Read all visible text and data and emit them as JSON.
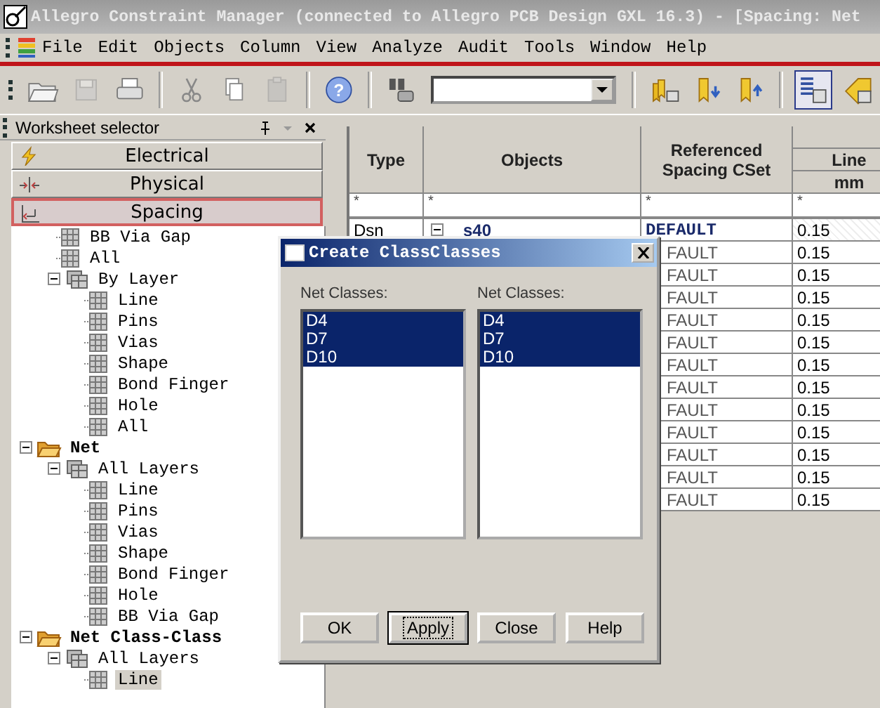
{
  "window": {
    "title": "Allegro Constraint Manager (connected to Allegro PCB Design GXL 16.3) - [Spacing:  Net"
  },
  "menu": [
    "File",
    "Edit",
    "Objects",
    "Column",
    "View",
    "Analyze",
    "Audit",
    "Tools",
    "Window",
    "Help"
  ],
  "toolbar": [
    {
      "kind": "open",
      "disabled": false
    },
    {
      "kind": "save",
      "disabled": true
    },
    {
      "kind": "print",
      "disabled": false
    },
    {
      "kind": "sep"
    },
    {
      "kind": "cut",
      "disabled": false
    },
    {
      "kind": "copy",
      "disabled": false
    },
    {
      "kind": "paste",
      "disabled": true
    },
    {
      "kind": "sep"
    },
    {
      "kind": "help",
      "glyph": "?",
      "disabled": false
    },
    {
      "kind": "sep"
    },
    {
      "kind": "find",
      "disabled": false
    },
    {
      "kind": "combo"
    },
    {
      "kind": "sep"
    },
    {
      "kind": "bookmarks",
      "disabled": false
    },
    {
      "kind": "bookmark-down",
      "disabled": false
    },
    {
      "kind": "bookmark-up",
      "disabled": false
    },
    {
      "kind": "sep"
    },
    {
      "kind": "sheet-view",
      "disabled": false
    },
    {
      "kind": "tag",
      "disabled": false
    }
  ],
  "worksheet_selector": {
    "title": "Worksheet selector",
    "domains": [
      {
        "label": "Electrical",
        "kind": "electrical",
        "selected": false
      },
      {
        "label": "Physical",
        "kind": "physical",
        "selected": false
      },
      {
        "label": "Spacing",
        "kind": "spacing",
        "selected": true
      }
    ],
    "tree": [
      {
        "kind": "hidden",
        "children": [
          {
            "label": "BB Via Gap",
            "kind": "sheet",
            "selected": false
          },
          {
            "label": "All",
            "kind": "sheet",
            "selected": false
          },
          {
            "label": "By Layer",
            "kind": "layers",
            "expanded": true,
            "selected": false,
            "children": [
              {
                "label": "Line",
                "kind": "sheet",
                "selected": false
              },
              {
                "label": "Pins",
                "kind": "sheet",
                "selected": false
              },
              {
                "label": "Vias",
                "kind": "sheet",
                "selected": false
              },
              {
                "label": "Shape",
                "kind": "sheet",
                "selected": false
              },
              {
                "label": "Bond Finger",
                "kind": "sheet",
                "selected": false
              },
              {
                "label": "Hole",
                "kind": "sheet",
                "selected": false
              },
              {
                "label": "All",
                "kind": "sheet",
                "selected": false
              }
            ]
          }
        ]
      },
      {
        "label": "Net",
        "kind": "folder",
        "expanded": true,
        "selected": false,
        "children": [
          {
            "label": "All Layers",
            "kind": "layers",
            "expanded": true,
            "selected": false,
            "children": [
              {
                "label": "Line",
                "kind": "sheet",
                "selected": false
              },
              {
                "label": "Pins",
                "kind": "sheet",
                "selected": false
              },
              {
                "label": "Vias",
                "kind": "sheet",
                "selected": false
              },
              {
                "label": "Shape",
                "kind": "sheet",
                "selected": false
              },
              {
                "label": "Bond Finger",
                "kind": "sheet",
                "selected": false
              },
              {
                "label": "Hole",
                "kind": "sheet",
                "selected": false
              },
              {
                "label": "BB Via Gap",
                "kind": "sheet",
                "selected": false
              }
            ]
          }
        ]
      },
      {
        "label": "Net Class-Class",
        "kind": "folder",
        "expanded": true,
        "selected": false,
        "children": [
          {
            "label": "All Layers",
            "kind": "layers",
            "expanded": true,
            "selected": false,
            "children": [
              {
                "label": "Line",
                "kind": "sheet",
                "selected": true
              }
            ]
          }
        ]
      }
    ]
  },
  "table": {
    "columns": [
      "Type",
      "Objects",
      "Referenced Spacing CSet"
    ],
    "group_column": {
      "label": "Line",
      "unit": "mm"
    },
    "filters": [
      "*",
      "*",
      "*",
      "*"
    ],
    "rows": [
      {
        "kind": "full",
        "type": "Dsn",
        "object": "s40",
        "expanded": true,
        "cset": "DEFAULT",
        "line": "0.15"
      },
      {
        "kind": "covered",
        "cset": "FAULT",
        "line": "0.15"
      },
      {
        "kind": "covered",
        "cset": "FAULT",
        "line": "0.15"
      },
      {
        "kind": "covered",
        "cset": "FAULT",
        "line": "0.15"
      },
      {
        "kind": "covered",
        "cset": "FAULT",
        "line": "0.15"
      },
      {
        "kind": "covered",
        "cset": "FAULT",
        "line": "0.15"
      },
      {
        "kind": "covered",
        "cset": "FAULT",
        "line": "0.15"
      },
      {
        "kind": "covered",
        "cset": "FAULT",
        "line": "0.15"
      },
      {
        "kind": "covered",
        "cset": "FAULT",
        "line": "0.15"
      },
      {
        "kind": "covered",
        "cset": "FAULT",
        "line": "0.15"
      },
      {
        "kind": "covered",
        "cset": "FAULT",
        "line": "0.15"
      },
      {
        "kind": "covered",
        "cset": "FAULT",
        "line": "0.15"
      },
      {
        "kind": "covered",
        "cset": "FAULT",
        "line": "0.15"
      }
    ]
  },
  "dialog": {
    "title": "Create ClassClasses",
    "lists": [
      {
        "label": "Net Classes:",
        "items": [
          {
            "text": "D4",
            "selected": true
          },
          {
            "text": "D7",
            "selected": true
          },
          {
            "text": "D10",
            "selected": true
          }
        ]
      },
      {
        "label": "Net Classes:",
        "items": [
          {
            "text": "D4",
            "selected": true
          },
          {
            "text": "D7",
            "selected": true
          },
          {
            "text": "D10",
            "selected": true
          }
        ]
      }
    ],
    "buttons": [
      {
        "label": "OK",
        "focused": false
      },
      {
        "label": "Apply",
        "focused": true
      },
      {
        "label": "Close",
        "focused": false
      },
      {
        "label": "Help",
        "focused": false
      }
    ]
  }
}
